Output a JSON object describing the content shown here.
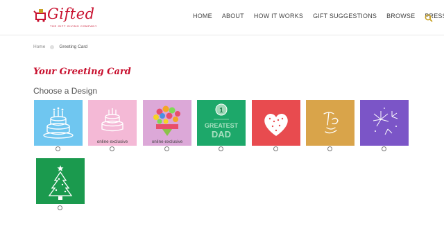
{
  "brand": {
    "name": "Gifted",
    "tagline": "THE GIFT GIVING COMPANY",
    "color": "#c8102e"
  },
  "nav": {
    "items": [
      "HOME",
      "ABOUT",
      "HOW IT WORKS",
      "GIFT SUGGESTIONS",
      "BROWSE",
      "PRESS"
    ],
    "search_icon": "search-icon",
    "search_color": "#c9a227"
  },
  "breadcrumb": {
    "home": "Home",
    "current": "Greeting Card"
  },
  "page_title": "Your Greeting Card",
  "section_title": "Choose a Design",
  "designs": [
    {
      "name": "birthday-cake-blue",
      "bg": "#6fc6f0",
      "caption": ""
    },
    {
      "name": "birthday-cake-pink",
      "bg": "#f4b9d6",
      "caption": "online exclusive"
    },
    {
      "name": "flower-bouquet",
      "bg": "#dca8d8",
      "caption": "online exclusive"
    },
    {
      "name": "greatest-dad",
      "bg": "#1da86a",
      "caption": "",
      "text": [
        "GREATEST",
        "DAD"
      ]
    },
    {
      "name": "heart",
      "bg": "#e84b4f",
      "caption": ""
    },
    {
      "name": "thank-you",
      "bg": "#d9a44a",
      "caption": ""
    },
    {
      "name": "fireworks",
      "bg": "#7b55c7",
      "caption": ""
    },
    {
      "name": "christmas-tree",
      "bg": "#1b9a4e",
      "caption": ""
    }
  ]
}
